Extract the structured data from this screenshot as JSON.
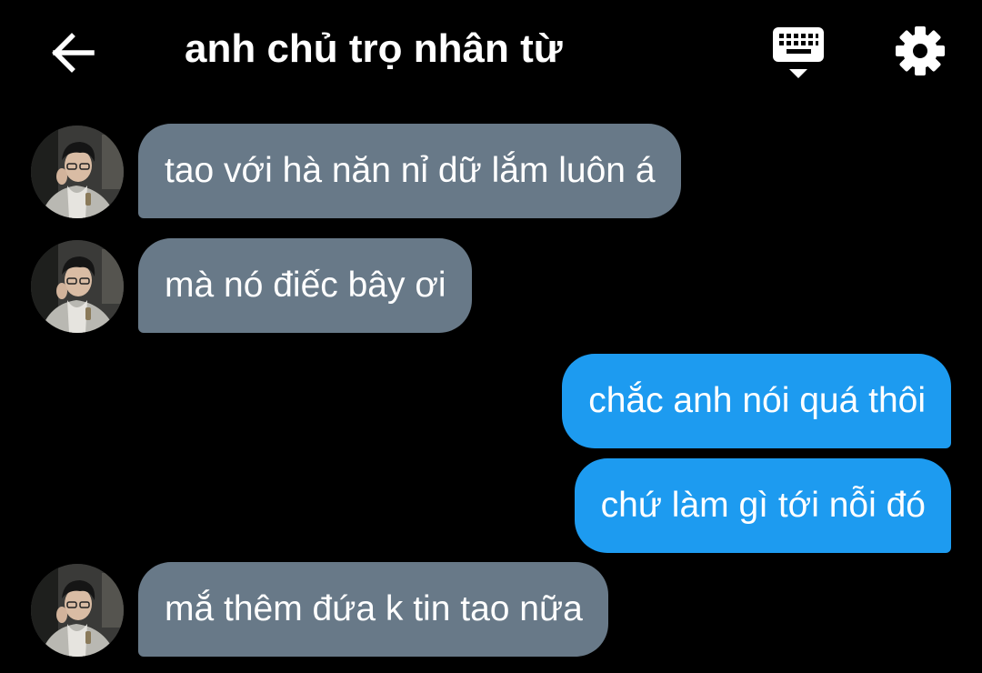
{
  "header": {
    "title": "anh chủ trọ nhân từ",
    "back_icon": "arrow-left-icon",
    "keyboard_icon": "keyboard-icon",
    "settings_icon": "gear-icon"
  },
  "colors": {
    "background": "#000000",
    "incoming_bubble": "#687988",
    "outgoing_bubble": "#1d9bf0",
    "text": "#ffffff"
  },
  "messages": [
    {
      "direction": "incoming",
      "text": "tao với hà năn nỉ dữ lắm luôn á"
    },
    {
      "direction": "incoming",
      "text": "mà nó điếc bây ơi"
    },
    {
      "direction": "outgoing",
      "text": "chắc anh nói quá thôi"
    },
    {
      "direction": "outgoing",
      "text": "chứ làm gì tới nỗi đó"
    },
    {
      "direction": "incoming",
      "text": "mắ thêm đứa k tin tao nữa"
    }
  ]
}
